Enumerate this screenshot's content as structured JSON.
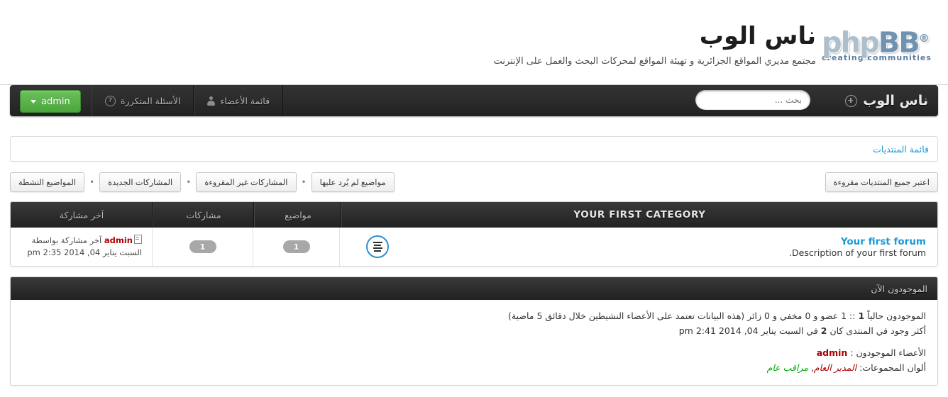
{
  "header": {
    "site_title": "ناس الوب",
    "site_description": "مجتمع مديري المواقع الجزائرية و تهيئة المواقع لمحركات البحث والعمل على الإنترنت",
    "logo_php": "php",
    "logo_bb": "BB",
    "logo_reg": "®",
    "logo_tagline": "creating communities"
  },
  "nav": {
    "home_label": "ناس الوب",
    "search_placeholder": "بحث ...",
    "search_value": "",
    "links": [
      {
        "label": "الأسئلة المتكررة",
        "icon": "faq-icon",
        "icon_glyph": "?"
      },
      {
        "label": "قائمة الأعضاء",
        "icon": "members-icon"
      }
    ],
    "user_button": "admin"
  },
  "panel": {
    "forum_index_link": "قائمة المنتديات"
  },
  "toolbar": {
    "mark_read": "اعتبر جميع المنتديات مقروءة",
    "filters": [
      "مواضيع لم يُرد عليها",
      "المشاركات غير المقروءة",
      "المشاركات الجديدة",
      "المواضيع النشطة"
    ],
    "separator": "•"
  },
  "forum_table": {
    "category_title": "YOUR FIRST CATEGORY",
    "columns": {
      "topics": "مواضيع",
      "posts": "مشاركات",
      "last_post": "آخر مشاركة"
    },
    "rows": [
      {
        "name": "Your first forum",
        "description": "Description of your first forum.",
        "topics": "1",
        "posts": "1",
        "last_post_prefix": "آخر مشاركة بواسطة",
        "last_post_author": "admin",
        "last_post_date": "السبت يناير 04, 2014 2:35 pm"
      }
    ]
  },
  "online": {
    "title": "الموجودون الآن",
    "stats_prefix": "الموجودون حالياً",
    "stats_count": "1",
    "stats_body": ":: 1 عضو و 0 مخفي و 0 زائر (هذه البيانات تعتمد على الأعضاء النشيطين خلال دقائق 5 ماضية)",
    "record_prefix": "أكثر وجود في المنتدى كان",
    "record_count": "2",
    "record_suffix": "في السبت يناير 04, 2014 2:41 pm",
    "members_label": "الأعضاء الموجودون :",
    "members": "admin",
    "legend_label": "ألوان المجموعات:",
    "group_admin": "المدير العام",
    "group_comma": ",",
    "group_mod": "مراقب عام"
  },
  "colors": {
    "link_blue": "#1a9ad6",
    "accent_green": "#4aa63c",
    "admin_red": "#aa0000",
    "mod_green": "#00aa00"
  }
}
